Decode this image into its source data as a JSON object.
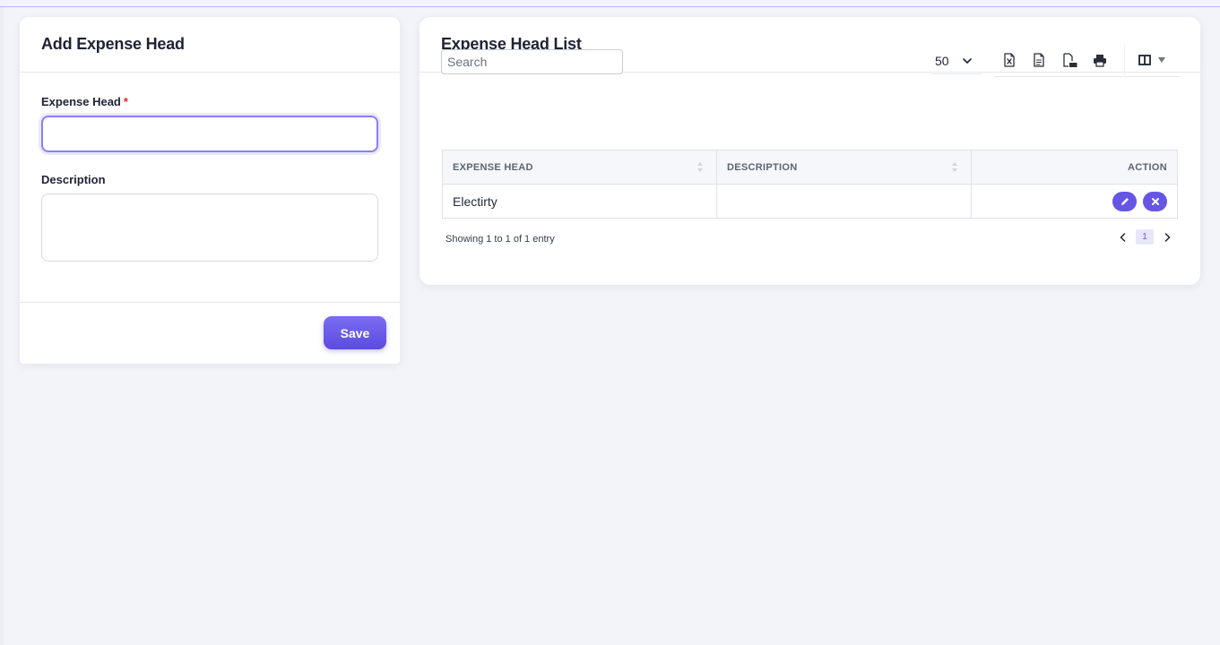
{
  "add_form": {
    "title": "Add Expense Head",
    "expense_head_label": "Expense Head",
    "required_mark": "*",
    "expense_head_value": "",
    "description_label": "Description",
    "description_value": "",
    "save_label": "Save"
  },
  "list": {
    "title": "Expense Head List",
    "search_placeholder": "Search",
    "page_size": "50",
    "export_icons": [
      "excel-icon",
      "csv-icon",
      "pdf-icon",
      "print-icon"
    ],
    "columns_icon": "columns-icon",
    "columns": [
      "EXPENSE HEAD",
      "DESCRIPTION",
      "ACTION"
    ],
    "rows": [
      {
        "expense_head": "Electirty",
        "description": ""
      }
    ],
    "info": "Showing 1 to 1 of 1 entry",
    "current_page": "1"
  },
  "colors": {
    "accent": "#6656e6",
    "background": "#f3f4f9"
  }
}
